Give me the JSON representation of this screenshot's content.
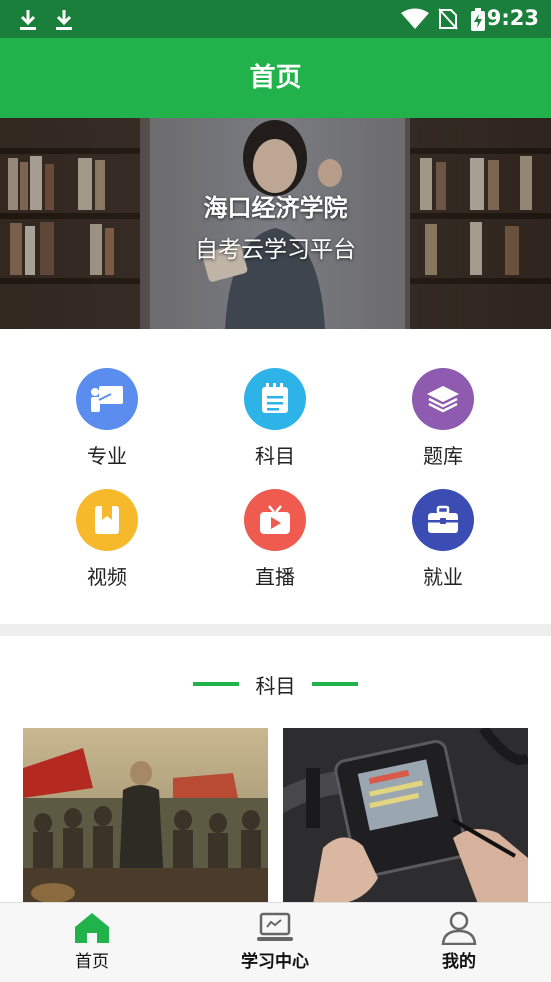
{
  "status_bar": {
    "time": "9:23",
    "icons": [
      "download-icon",
      "download-icon",
      "wifi-icon",
      "no-sim-icon",
      "battery-charging-icon"
    ]
  },
  "app_bar": {
    "title": "首页"
  },
  "banner": {
    "line1": "海口经济学院",
    "line2": "自考云学习平台"
  },
  "grid": [
    {
      "label": "专业",
      "icon": "presentation-icon",
      "color": "#5b8def"
    },
    {
      "label": "科目",
      "icon": "notebook-icon",
      "color": "#2eb3e8"
    },
    {
      "label": "题库",
      "icon": "layers-icon",
      "color": "#8e5bb0"
    },
    {
      "label": "视频",
      "icon": "bookmark-book-icon",
      "color": "#f6b92b"
    },
    {
      "label": "直播",
      "icon": "tv-play-icon",
      "color": "#ef5b4f"
    },
    {
      "label": "就业",
      "icon": "briefcase-icon",
      "color": "#3b4db3"
    }
  ],
  "section": {
    "title": "科目"
  },
  "cards": [
    {
      "name": "history-painting-card"
    },
    {
      "name": "car-diagnostics-card"
    }
  ],
  "bottom_nav": {
    "tabs": [
      {
        "label": "首页",
        "icon": "home-icon",
        "active": true
      },
      {
        "label": "学习中心",
        "icon": "laptop-icon",
        "active": false
      },
      {
        "label": "我的",
        "icon": "user-icon",
        "active": false
      }
    ],
    "active_color": "#22b24c"
  }
}
